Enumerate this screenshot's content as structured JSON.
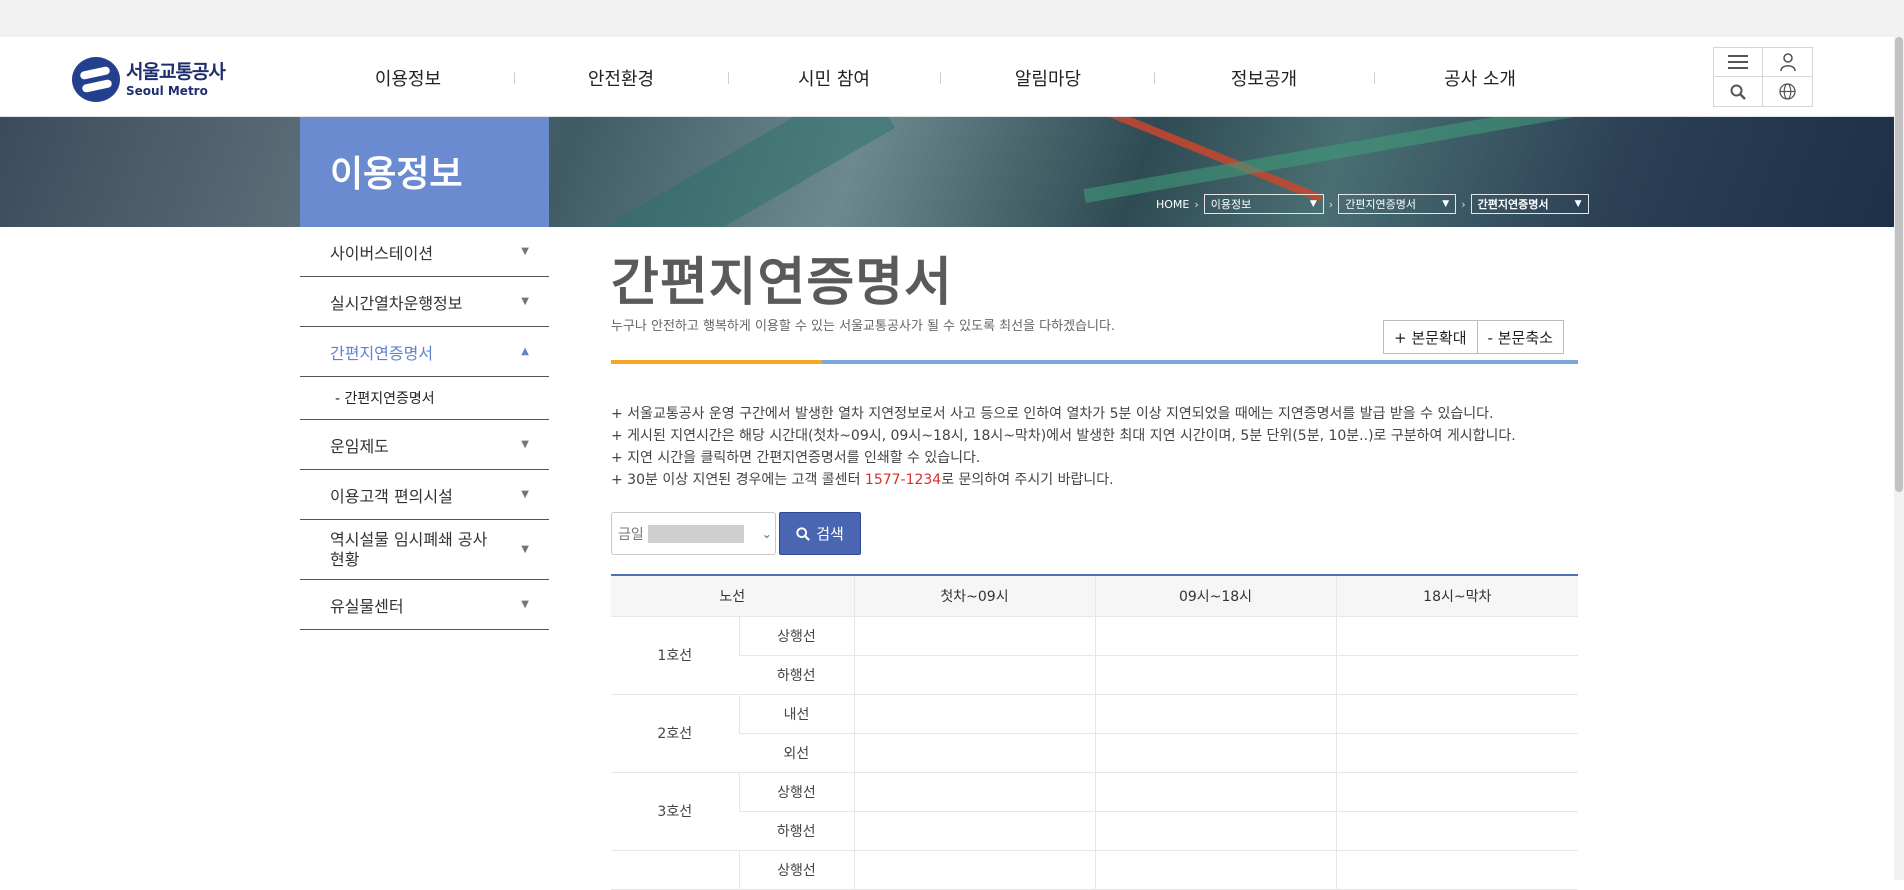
{
  "header": {
    "logo_ko": "서울교통공사",
    "logo_en": "Seoul Metro",
    "nav": [
      "이용정보",
      "안전환경",
      "시민 참여",
      "알림마당",
      "정보공개",
      "공사 소개"
    ],
    "util_icons": [
      "menu-icon",
      "user-icon",
      "search-icon",
      "globe-icon"
    ]
  },
  "banner": {
    "section_title": "이용정보",
    "breadcrumb": {
      "home": "HOME",
      "level1": "이용정보",
      "level2": "간편지연증명서",
      "level3": "간편지연증명서"
    }
  },
  "lnb": {
    "items": [
      "사이버스테이션",
      "실시간열차운행정보",
      "간편지연증명서",
      "운임제도",
      "이용고객 편의시설",
      "역시설물 임시폐쇄 공사현황",
      "유실물센터"
    ],
    "sub_item": "- 간편지연증명서"
  },
  "content": {
    "title": "간편지연증명서",
    "description": "누구나 안전하고 행복하게 이용할 수 있는 서울교통공사가 될 수 있도록 최선을 다하겠습니다.",
    "zoom_in": "+ 본문확대",
    "zoom_out": "- 본문축소",
    "notes": [
      "+ 서울교통공사 운영 구간에서 발생한 열차 지연정보로서 사고 등으로 인하여 열차가 5분 이상 지연되었을 때에는 지연증명서를 발급 받을 수 있습니다.",
      "+ 게시된 지연시간은 해당 시간대(첫차~09시, 09시~18시, 18시~막차)에서 발생한 최대 지연 시간이며, 5분 단위(5분, 10분..)로 구분하여 게시합니다.",
      "+ 지연 시간을 클릭하면 간편지연증명서를 인쇄할 수 있습니다."
    ],
    "note4_prefix": "+ 30분 이상 지연된 경우에는 고객 콜센터 ",
    "note4_phone": "1577-1234",
    "note4_suffix": "로 문의하여 주시기 바랍니다.",
    "search": {
      "select_label": "금일",
      "button": "검색"
    },
    "table": {
      "headers": [
        "노선",
        "첫차~09시",
        "09시~18시",
        "18시~막차"
      ],
      "lines": [
        {
          "name": "1호선",
          "directions": [
            "상행선",
            "하행선"
          ]
        },
        {
          "name": "2호선",
          "directions": [
            "내선",
            "외선"
          ]
        },
        {
          "name": "3호선",
          "directions": [
            "상행선",
            "하행선"
          ]
        }
      ],
      "partial_row": "상행선"
    }
  },
  "colors": {
    "brand_navy": "#23408e",
    "lnb_title_bg": "#6b8bd1",
    "active_text": "#5f83cf",
    "search_button": "#4a66b3",
    "phone_highlight": "#d2322d",
    "title_line_orange": "#f5a623",
    "title_line_blue": "#7aa9d6"
  }
}
